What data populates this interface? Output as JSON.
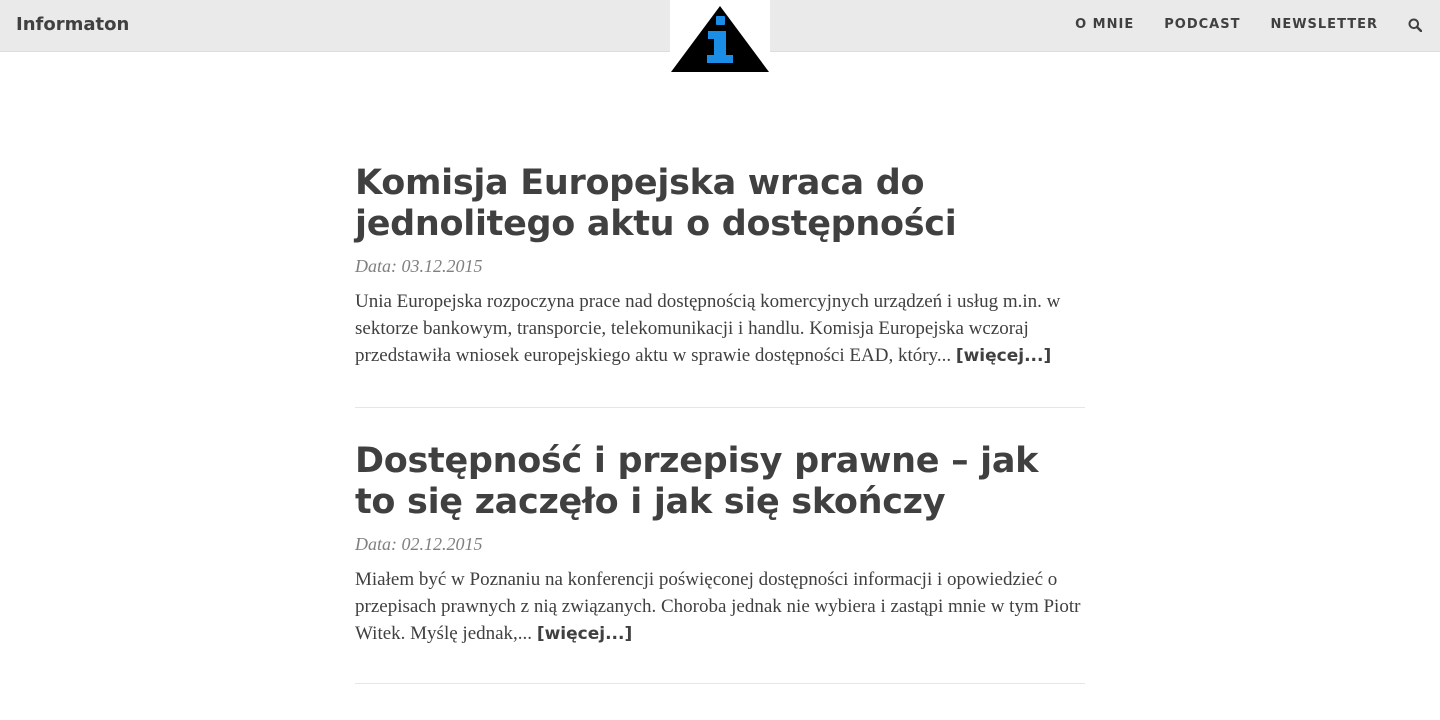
{
  "header": {
    "brand": "Informaton",
    "nav": [
      "O MNIE",
      "PODCAST",
      "NEWSLETTER"
    ],
    "search_icon": "search-icon",
    "logo_icon": "info-triangle-icon",
    "colors": {
      "bar": "#eaeaea",
      "logo_triangle": "#000000",
      "logo_i": "#1a8ee6"
    }
  },
  "posts": [
    {
      "title": "Komisja Europejska wraca do jednolitego aktu o dostępności",
      "date": "Data: 03.12.2015",
      "excerpt": "Unia Europejska rozpoczyna prace nad dostępnością komercyjnych urządzeń i usług m.in. w sektorze bankowym, transporcie, telekomunikacji i handlu. Komisja Europejska wczoraj przedstawiła wniosek europejskiego aktu w sprawie dostępności EAD, który...",
      "more": "[więcej...]"
    },
    {
      "title": "Dostępność i przepisy prawne – jak to się zaczęło i jak się skończy",
      "date": "Data: 02.12.2015",
      "excerpt": "Miałem być w Poznaniu na konferencji poświęconej dostępności informacji i opowiedzieć o przepisach prawnych z nią związanych. Choroba jednak nie wybiera i zastąpi mnie w tym Piotr Witek. Myślę jednak,...",
      "more": "[więcej...]"
    }
  ]
}
